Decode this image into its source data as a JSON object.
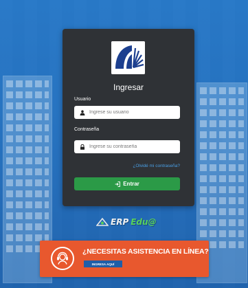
{
  "login": {
    "title": "Ingresar",
    "username_label": "Usuario",
    "username_placeholder": "Ingrese su usuario",
    "password_label": "Contraseña",
    "password_placeholder": "Ingrese su contraseña",
    "forgot_link": "¿Olvidé mi contraseña?",
    "submit_label": "Entrar"
  },
  "brand": {
    "erp_text": "ERP",
    "edu_text": "Edu@"
  },
  "help_banner": {
    "headline": "¿NECESITAS ASISTENCIA EN LÍNEA?",
    "cta_label": "INGRESA AQUÍ"
  },
  "colors": {
    "background": "#2d7ec4",
    "card": "#2f3236",
    "submit": "#2b9a47",
    "link": "#4aa0e6",
    "banner": "#e8582e",
    "banner_cta": "#1f5ea8",
    "brand_green": "#58d05c"
  },
  "icons": {
    "username": "user-icon",
    "password": "lock-icon",
    "submit": "sign-in-icon",
    "banner": "headset-support-icon",
    "brand": "erp-logo-icon",
    "university": "university-logo-icon"
  }
}
